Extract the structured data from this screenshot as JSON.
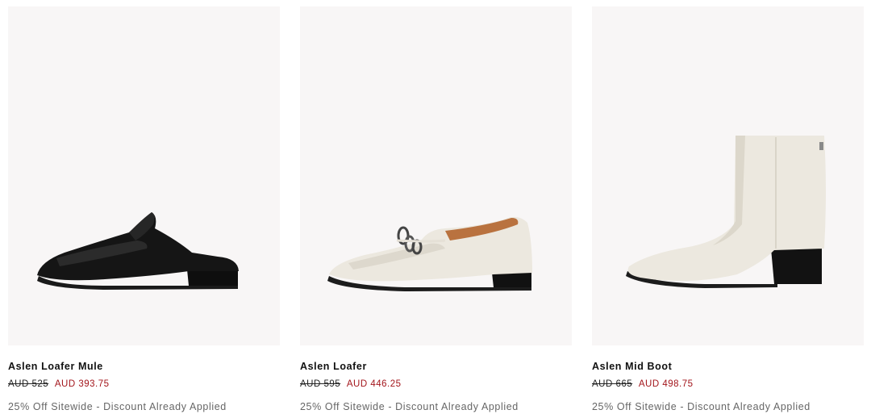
{
  "colors": {
    "image_bg": "#f8f6f6",
    "name": "#111111",
    "sale_price": "#a3151b",
    "promo": "#666666"
  },
  "products": [
    {
      "name": "Aslen Loafer Mule",
      "original_price": "AUD 525",
      "sale_price": "AUD 393.75",
      "promo": "25% Off Sitewide - Discount Already Applied",
      "image_icon": "black-loafer-mule-image"
    },
    {
      "name": "Aslen Loafer",
      "original_price": "AUD 595",
      "sale_price": "AUD 446.25",
      "promo": "25% Off Sitewide - Discount Already Applied",
      "image_icon": "white-chain-loafer-image"
    },
    {
      "name": "Aslen Mid Boot",
      "original_price": "AUD 665",
      "sale_price": "AUD 498.75",
      "promo": "25% Off Sitewide - Discount Already Applied",
      "image_icon": "white-ankle-boot-image"
    }
  ]
}
